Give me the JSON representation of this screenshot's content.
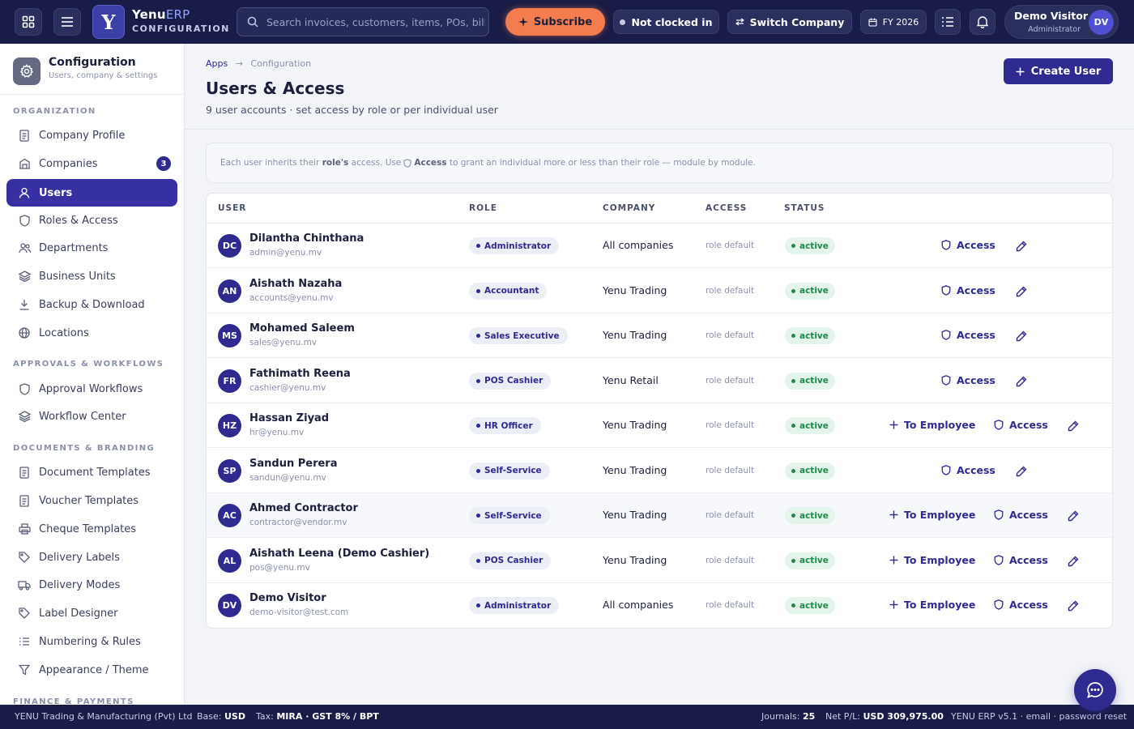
{
  "topbar": {
    "brand_main": "Yenu",
    "brand_accent": "ERP",
    "brand_sub": "CONFIGURATION",
    "search_placeholder": "Search invoices, customers, items, POs, bills...",
    "subscribe_label": "Subscribe",
    "clock_status": "Not clocked in",
    "switch_company_label": "Switch Company",
    "fiscal_year": "FY 2026",
    "user_name": "Demo Visitor",
    "user_role": "Administrator",
    "user_initials": "DV"
  },
  "sidebar": {
    "title": "Configuration",
    "subtitle": "Users, company & settings",
    "sections": {
      "organization": "ORGANIZATION",
      "approvals": "APPROVALS & WORKFLOWS",
      "documents": "DOCUMENTS & BRANDING",
      "finance": "FINANCE & PAYMENTS"
    },
    "items": {
      "company_profile": "Company Profile",
      "companies": "Companies",
      "companies_count": "3",
      "users": "Users",
      "roles": "Roles & Access",
      "departments": "Departments",
      "business_units": "Business Units",
      "backup": "Backup & Download",
      "locations": "Locations",
      "approval_workflows": "Approval Workflows",
      "workflow_center": "Workflow Center",
      "document_templates": "Document Templates",
      "voucher_templates": "Voucher Templates",
      "cheque_templates": "Cheque Templates",
      "delivery_labels": "Delivery Labels",
      "delivery_modes": "Delivery Modes",
      "label_designer": "Label Designer",
      "numbering": "Numbering & Rules",
      "appearance": "Appearance / Theme"
    }
  },
  "page": {
    "crumb_apps": "Apps",
    "crumb_sep": "→",
    "crumb_current": "Configuration",
    "title": "Users & Access",
    "subtitle": "9 user accounts · set access by role or per individual user",
    "create_label": "Create User",
    "info_1": "Each user inherits their",
    "info_role": "role's",
    "info_2": "access. Use",
    "info_access": "Access",
    "info_3": "to grant an individual more or less than their role — module by module."
  },
  "table": {
    "headers": {
      "user": "USER",
      "role": "ROLE",
      "company": "COMPANY",
      "access": "ACCESS",
      "status": "STATUS"
    },
    "access_label": "Access",
    "to_employee_label": "To Employee",
    "rows": [
      {
        "initials": "DC",
        "name": "Dilantha Chinthana",
        "email": "admin@yenu.mv",
        "role": "Administrator",
        "company": "All companies",
        "access": "role default",
        "status": "active",
        "to_employee": false
      },
      {
        "initials": "AN",
        "name": "Aishath Nazaha",
        "email": "accounts@yenu.mv",
        "role": "Accountant",
        "company": "Yenu Trading",
        "access": "role default",
        "status": "active",
        "to_employee": false
      },
      {
        "initials": "MS",
        "name": "Mohamed Saleem",
        "email": "sales@yenu.mv",
        "role": "Sales Executive",
        "company": "Yenu Trading",
        "access": "role default",
        "status": "active",
        "to_employee": false
      },
      {
        "initials": "FR",
        "name": "Fathimath Reena",
        "email": "cashier@yenu.mv",
        "role": "POS Cashier",
        "company": "Yenu Retail",
        "access": "role default",
        "status": "active",
        "to_employee": false
      },
      {
        "initials": "HZ",
        "name": "Hassan Ziyad",
        "email": "hr@yenu.mv",
        "role": "HR Officer",
        "company": "Yenu Trading",
        "access": "role default",
        "status": "active",
        "to_employee": true
      },
      {
        "initials": "SP",
        "name": "Sandun Perera",
        "email": "sandun@yenu.mv",
        "role": "Self-Service",
        "company": "Yenu Trading",
        "access": "role default",
        "status": "active",
        "to_employee": false
      },
      {
        "initials": "AC",
        "name": "Ahmed Contractor",
        "email": "contractor@vendor.mv",
        "role": "Self-Service",
        "company": "Yenu Trading",
        "access": "role default",
        "status": "active",
        "to_employee": true
      },
      {
        "initials": "AL",
        "name": "Aishath Leena (Demo Cashier)",
        "email": "pos@yenu.mv",
        "role": "POS Cashier",
        "company": "Yenu Trading",
        "access": "role default",
        "status": "active",
        "to_employee": true
      },
      {
        "initials": "DV",
        "name": "Demo Visitor",
        "email": "demo-visitor@test.com",
        "role": "Administrator",
        "company": "All companies",
        "access": "role default",
        "status": "active",
        "to_employee": true
      }
    ]
  },
  "footer": {
    "company": "YENU Trading & Manufacturing (Pvt) Ltd",
    "base_label": "Base:",
    "base_value": "USD",
    "tax_label": "Tax:",
    "tax_value": "MIRA · GST 8% / BPT",
    "journals_label": "Journals:",
    "journals_value": "25",
    "pl_label": "Net P/L:",
    "pl_value": "USD 309,975.00",
    "version": "YENU ERP v5.1 · email · password reset"
  },
  "colors": {
    "accent": "#2e2a8f",
    "topbar": "#191c46",
    "subscribe": "#f47d50",
    "status_green": "#1e8a4c"
  }
}
